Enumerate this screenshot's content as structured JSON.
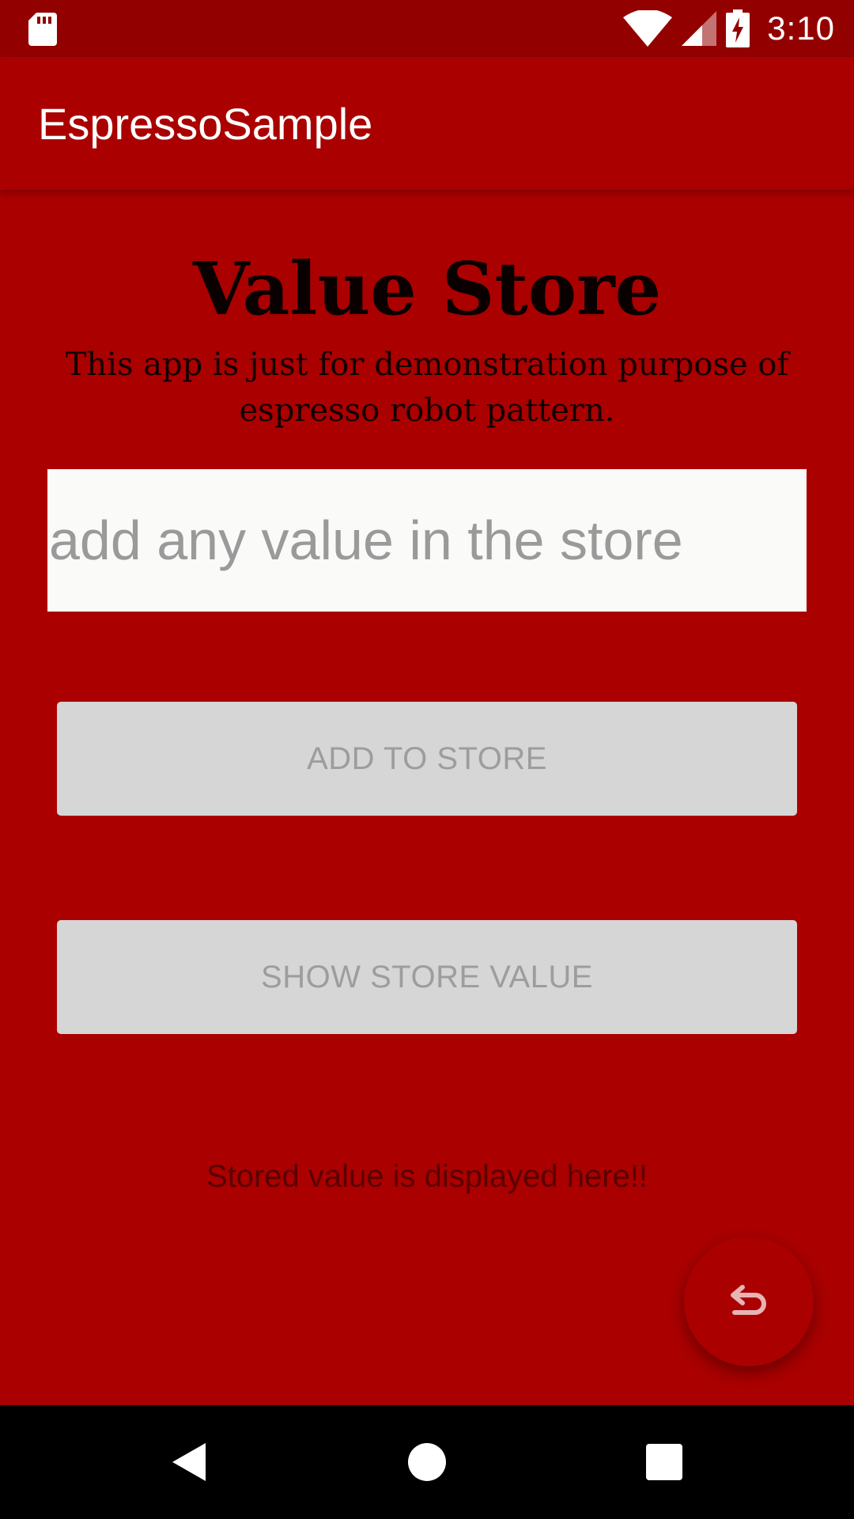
{
  "status_bar": {
    "time": "3:10",
    "icons": [
      "sd-card-icon",
      "wifi-icon",
      "signal-icon",
      "battery-charging-icon"
    ]
  },
  "app_bar": {
    "title": "EspressoSample"
  },
  "main": {
    "headline": "Value Store",
    "subtitle": "This app is just for demonstration purpose of espresso robot pattern.",
    "input": {
      "placeholder": "add any value in the store",
      "value": ""
    },
    "add_button_label": "ADD TO STORE",
    "show_button_label": "SHOW STORE VALUE",
    "stored_value_text": "Stored value is displayed here!!"
  },
  "fab": {
    "icon": "undo-icon"
  },
  "nav_bar": {
    "icons": [
      "back-icon",
      "home-icon",
      "recents-icon"
    ]
  },
  "colors": {
    "primary": "#aa0000",
    "primary_dark": "#930000",
    "button_bg": "#d6d6d6",
    "button_text": "#9d9d9d",
    "input_bg": "#fafaf9"
  }
}
